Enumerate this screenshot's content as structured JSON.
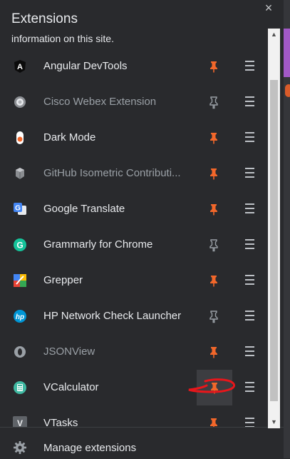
{
  "header": {
    "title": "Extensions",
    "subtitle": "information on this site.",
    "close_glyph": "×"
  },
  "extensions": [
    {
      "name": "Angular DevTools",
      "icon": "angular-icon",
      "pinned": true,
      "dim": false
    },
    {
      "name": "Cisco Webex Extension",
      "icon": "webex-icon",
      "pinned": false,
      "dim": true
    },
    {
      "name": "Dark Mode",
      "icon": "dark-mode-icon",
      "pinned": true,
      "dim": false
    },
    {
      "name": "GitHub Isometric Contributi...",
      "icon": "github-isometric-icon",
      "pinned": true,
      "dim": true
    },
    {
      "name": "Google Translate",
      "icon": "google-translate-icon",
      "pinned": true,
      "dim": false
    },
    {
      "name": "Grammarly for Chrome",
      "icon": "grammarly-icon",
      "pinned": false,
      "dim": false
    },
    {
      "name": "Grepper",
      "icon": "grepper-icon",
      "pinned": true,
      "dim": false
    },
    {
      "name": "HP Network Check Launcher",
      "icon": "hp-icon",
      "pinned": false,
      "dim": false
    },
    {
      "name": "JSONView",
      "icon": "jsonview-icon",
      "pinned": true,
      "dim": true
    },
    {
      "name": "VCalculator",
      "icon": "vcalculator-icon",
      "pinned": true,
      "dim": false
    },
    {
      "name": "VTasks",
      "icon": "vtasks-icon",
      "pinned": true,
      "dim": false
    }
  ],
  "icon_glyphs": {
    "angular": "A",
    "translate": "G",
    "grammarly": "G",
    "hp": "hp",
    "vtasks": "V"
  },
  "footer": {
    "manage_label": "Manage extensions"
  },
  "colors": {
    "pin_active": "#f2672a",
    "pin_inactive": "#9aa0a6",
    "annotation": "#e8161b",
    "background": "#292a2d"
  }
}
